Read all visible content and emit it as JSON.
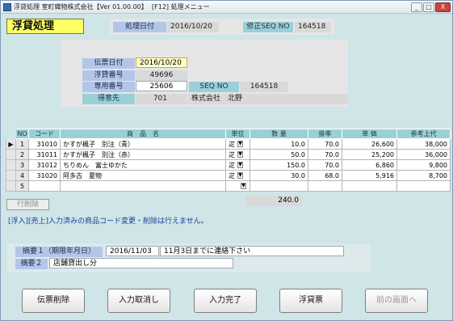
{
  "window": {
    "title": "浮貸処理 室町織物株式会社【Ver 01.00.00】",
    "menu_label": "[F12] 処理メニュー",
    "min_label": "_",
    "max_label": "□",
    "close_label": "X"
  },
  "header": {
    "screen_title": "浮貸処理",
    "process_date_label": "処理日付",
    "process_date_value": "2016/10/20",
    "seq_label": "修正SEQ NO",
    "seq_value": "164518"
  },
  "slip": {
    "date_label": "伝票日付",
    "date_value": "2016/10/20",
    "number_label": "浮貸番号",
    "number_value": "49696",
    "dedicated_label": "専用番号",
    "dedicated_value": "25606",
    "seq_label": "SEQ NO",
    "seq_value": "164518",
    "customer_label": "得意先",
    "customer_code": "701",
    "customer_name": "株式会社　北野"
  },
  "grid": {
    "columns": [
      "NO",
      "コード",
      "商　品　名",
      "単位",
      "数 量",
      "掛率",
      "単 価",
      "参考上代"
    ],
    "rows": [
      {
        "no": "1",
        "code": "31010",
        "name": "かすが楓子　別注（青）",
        "unit": "疋",
        "qty": "10.0",
        "rate": "70.0",
        "price": "26,600",
        "retail": "38,000"
      },
      {
        "no": "2",
        "code": "31011",
        "name": "かすが楓子　別注（赤）",
        "unit": "疋",
        "qty": "50.0",
        "rate": "70.0",
        "price": "25,200",
        "retail": "36,000"
      },
      {
        "no": "3",
        "code": "31012",
        "name": "ちりめん　富士ゆかた",
        "unit": "疋",
        "qty": "150.0",
        "rate": "70.0",
        "price": "6,860",
        "retail": "9,800"
      },
      {
        "no": "4",
        "code": "31020",
        "name": "阿多古　夏物",
        "unit": "疋",
        "qty": "30.0",
        "rate": "68.0",
        "price": "5,916",
        "retail": "8,700"
      },
      {
        "no": "5",
        "code": "",
        "name": "",
        "unit": "",
        "qty": "",
        "rate": "",
        "price": "",
        "retail": ""
      }
    ],
    "total_qty": "240.0",
    "row_delete_label": "行削除"
  },
  "notice": "[浮入][売上]入力済みの商品コード変更・削除は行えません。",
  "memo": {
    "memo1_label": "摘要１（期限年月日）",
    "memo1_date": "2016/11/03",
    "memo1_text": "11月3日までに連絡下さい",
    "memo2_label": "摘要２",
    "memo2_text": "店舗貸出し分"
  },
  "buttons": {
    "delete_slip": "伝票削除",
    "cancel_input": "入力取消し",
    "complete_input": "入力完了",
    "voucher": "浮貸票",
    "prev_screen": "前の画面へ"
  }
}
